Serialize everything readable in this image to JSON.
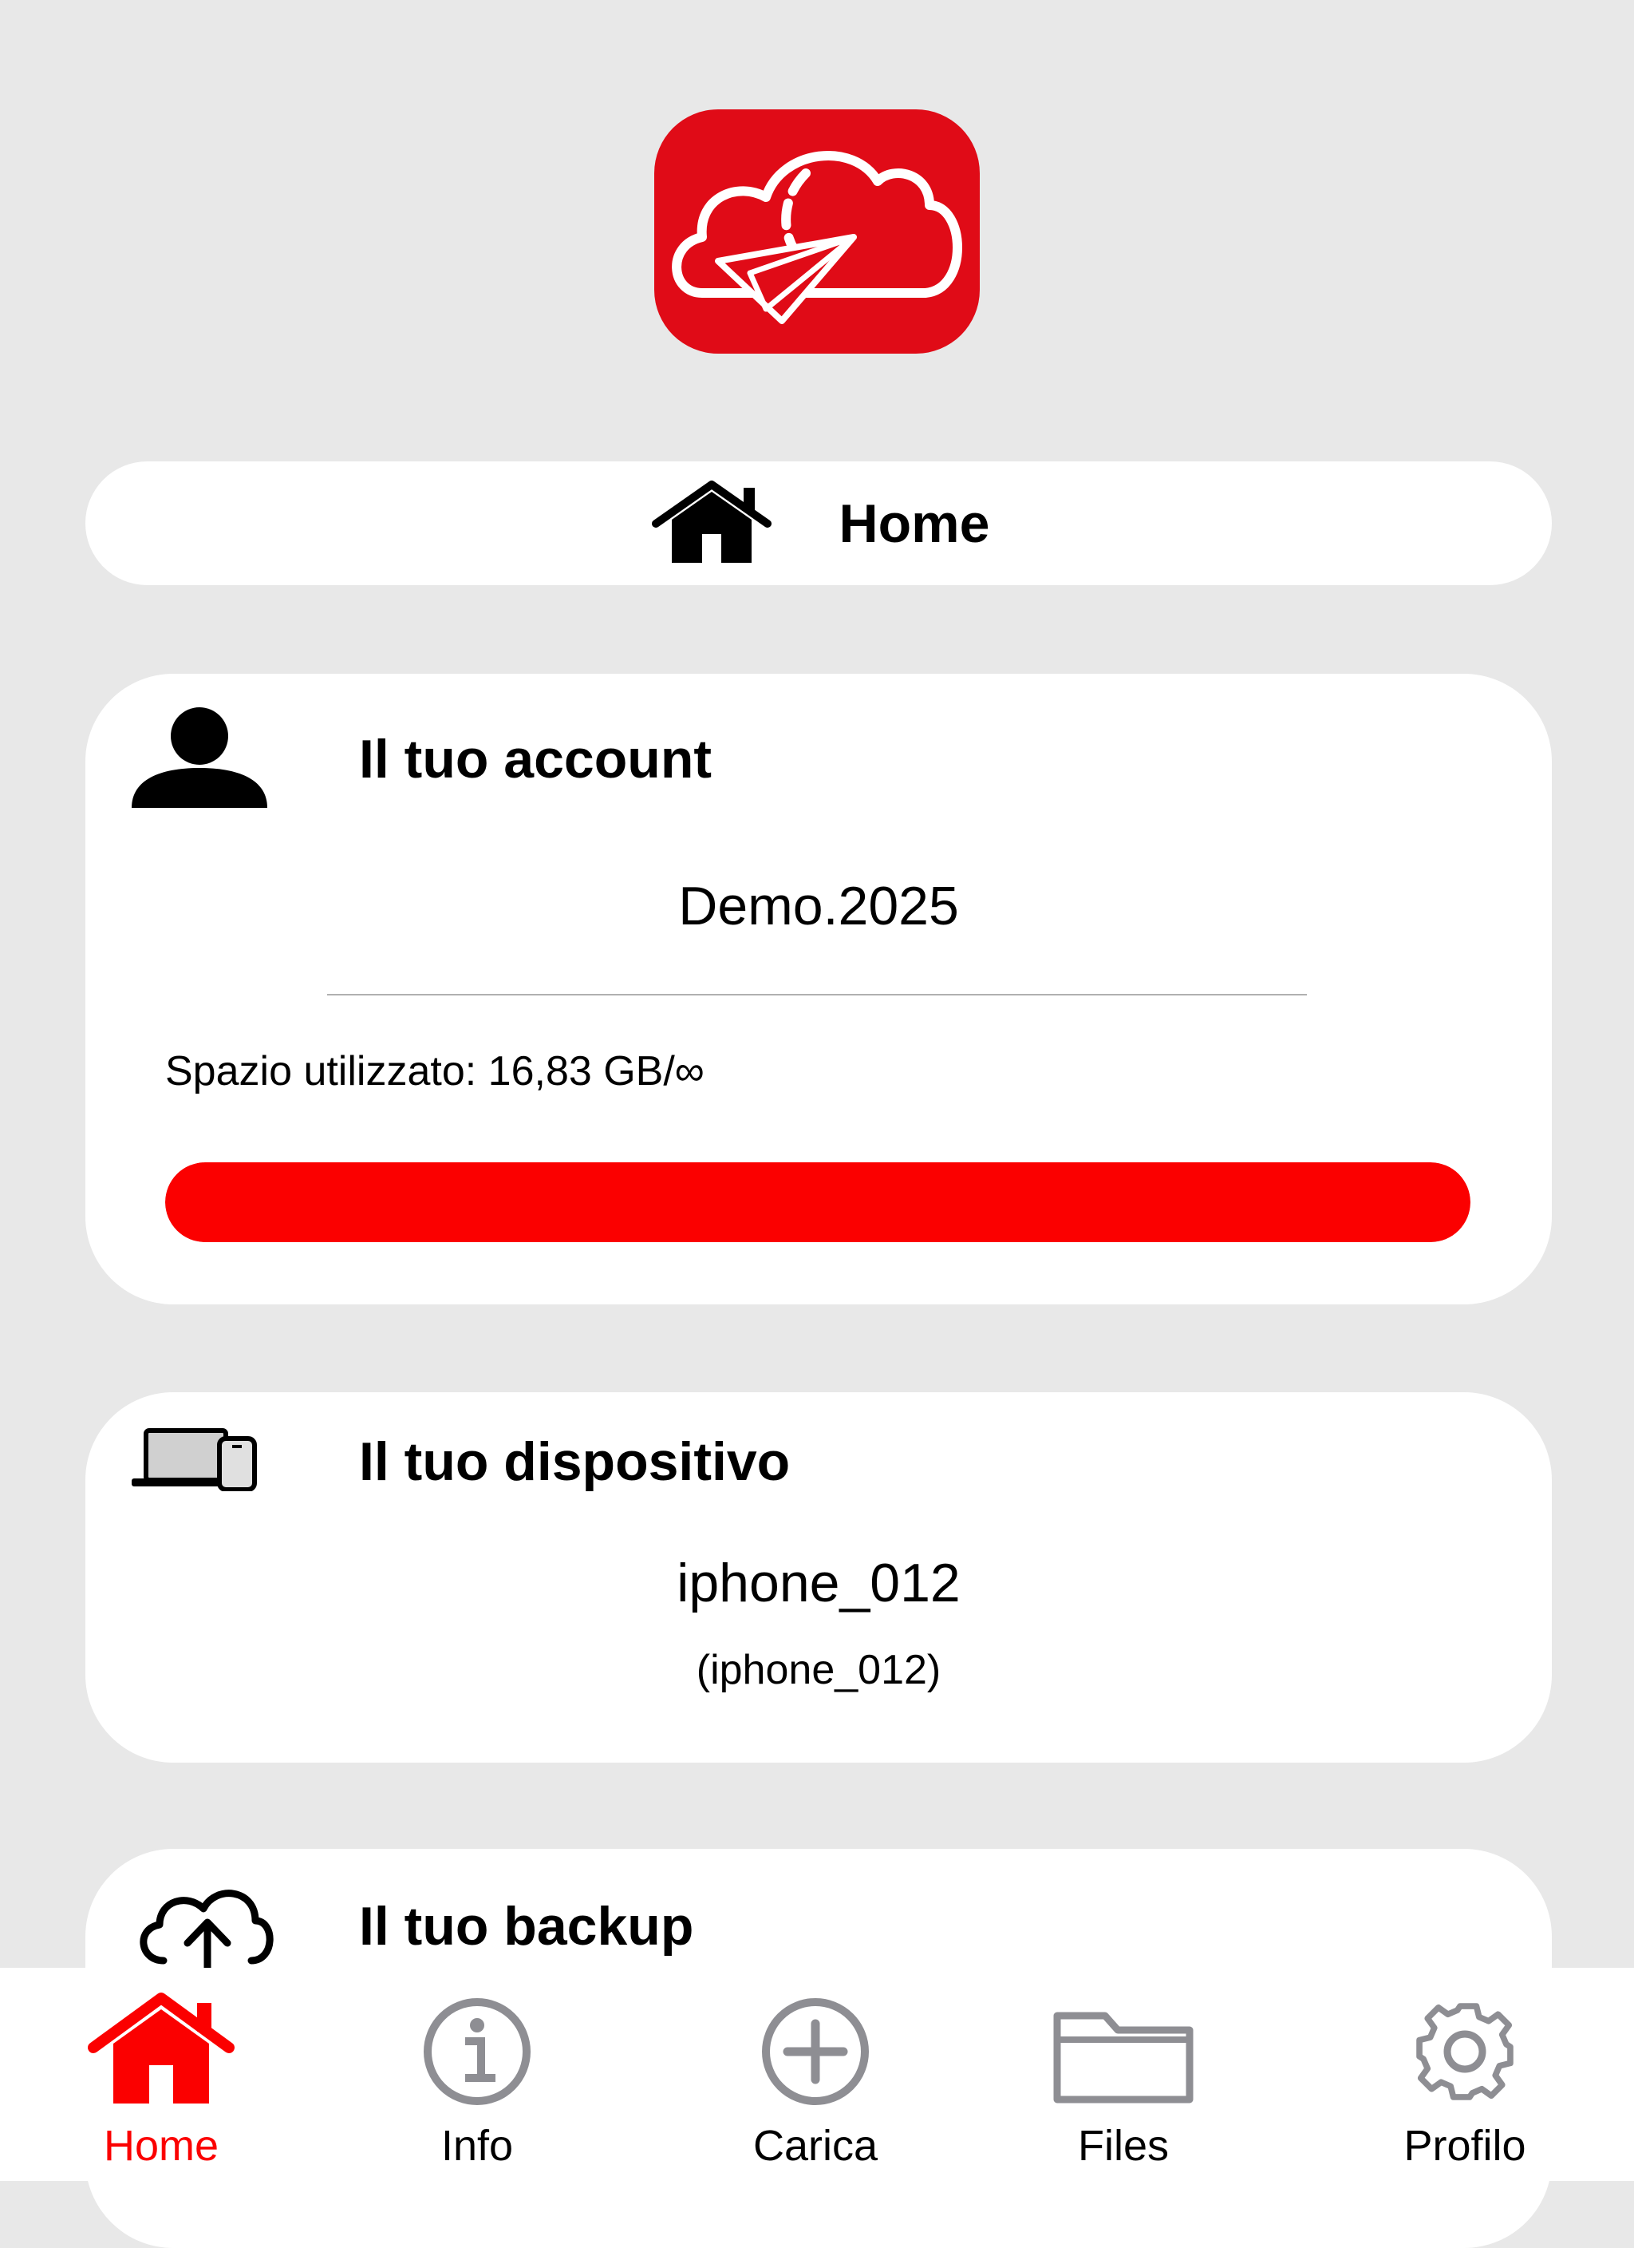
{
  "header": {
    "title": "Home"
  },
  "account": {
    "title": "Il tuo account",
    "name": "Demo.2025",
    "space_label": "Spazio utilizzato: 16,83 GB/∞",
    "usage_fraction": 1.0
  },
  "device": {
    "title": "Il tuo dispositivo",
    "name": "iphone_012",
    "subtitle": "(iphone_012)"
  },
  "backup": {
    "title": "Il tuo backup"
  },
  "tabbar": {
    "items": [
      {
        "label": "Home",
        "icon": "home-icon",
        "active": true
      },
      {
        "label": "Info",
        "icon": "info-icon",
        "active": false
      },
      {
        "label": "Carica",
        "icon": "add-circle-icon",
        "active": false
      },
      {
        "label": "Files",
        "icon": "folder-icon",
        "active": false
      },
      {
        "label": "Profilo",
        "icon": "gear-icon",
        "active": false
      }
    ]
  },
  "colors": {
    "brand": "#e00b17",
    "accent": "#fb0000",
    "inactive_icon": "#8e8e93"
  }
}
